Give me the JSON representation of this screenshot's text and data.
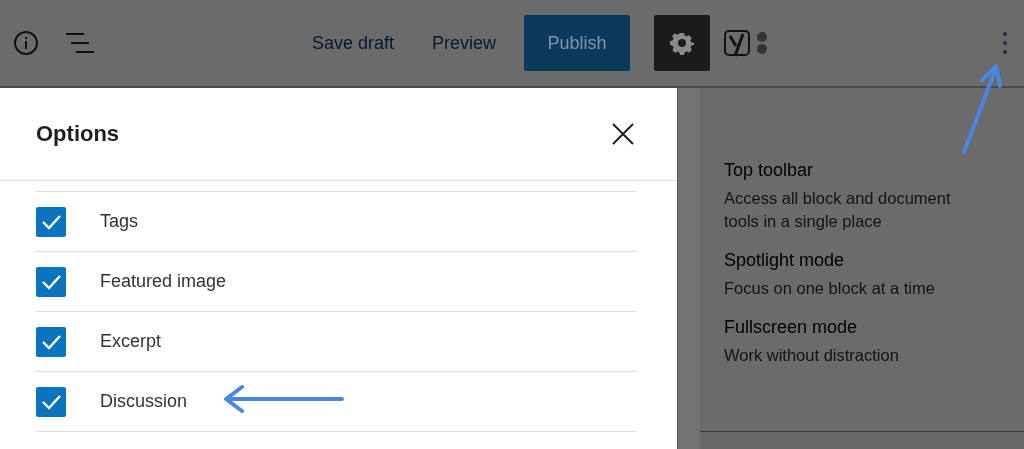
{
  "toolbar": {
    "links": [
      {
        "label": "Save draft"
      },
      {
        "label": "Preview"
      }
    ],
    "publish": {
      "label": "Publish"
    },
    "settings": {
      "pressed": true
    }
  },
  "modal": {
    "title": "Options",
    "options": [
      {
        "label": "Tags",
        "checked": true
      },
      {
        "label": "Featured image",
        "checked": true
      },
      {
        "label": "Excerpt",
        "checked": true
      },
      {
        "label": "Discussion",
        "checked": true
      }
    ]
  },
  "menu": {
    "items": [
      {
        "title": "Top toolbar",
        "description": "Access all block and document tools in a single place"
      },
      {
        "title": "Spotlight mode",
        "description": "Focus on one block at a time"
      },
      {
        "title": "Fullscreen mode",
        "description": "Work without distraction"
      }
    ]
  }
}
